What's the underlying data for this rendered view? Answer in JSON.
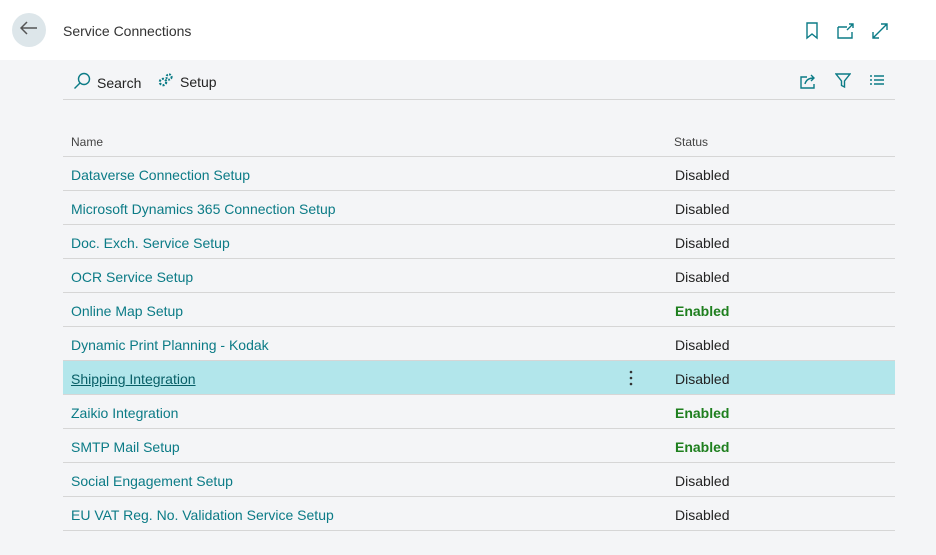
{
  "header": {
    "title": "Service Connections",
    "icons": [
      "back-arrow-icon",
      "bookmark-icon",
      "open-in-new-window-icon",
      "expand-icon"
    ]
  },
  "actions": {
    "search_label": "Search",
    "setup_label": "Setup",
    "right_icons": [
      "share-icon",
      "filter-icon",
      "list-view-icon"
    ]
  },
  "table": {
    "columns": {
      "name": "Name",
      "status": "Status"
    },
    "rows": [
      {
        "name": "Dataverse Connection Setup",
        "status": "Disabled"
      },
      {
        "name": "Microsoft Dynamics 365 Connection Setup",
        "status": "Disabled"
      },
      {
        "name": "Doc. Exch. Service Setup",
        "status": "Disabled"
      },
      {
        "name": "OCR Service Setup",
        "status": "Disabled"
      },
      {
        "name": "Online Map Setup",
        "status": "Enabled"
      },
      {
        "name": "Dynamic Print Planning - Kodak",
        "status": "Disabled"
      },
      {
        "name": "Shipping Integration",
        "status": "Disabled"
      },
      {
        "name": "Zaikio Integration",
        "status": "Enabled"
      },
      {
        "name": "SMTP Mail Setup",
        "status": "Enabled"
      },
      {
        "name": "Social Engagement Setup",
        "status": "Disabled"
      },
      {
        "name": "EU VAT Reg. No. Validation Service Setup",
        "status": "Disabled"
      }
    ]
  },
  "colors": {
    "accent": "#0b7b86",
    "selected_row": "#b2e6eb",
    "enabled": "#1e7f1e"
  }
}
